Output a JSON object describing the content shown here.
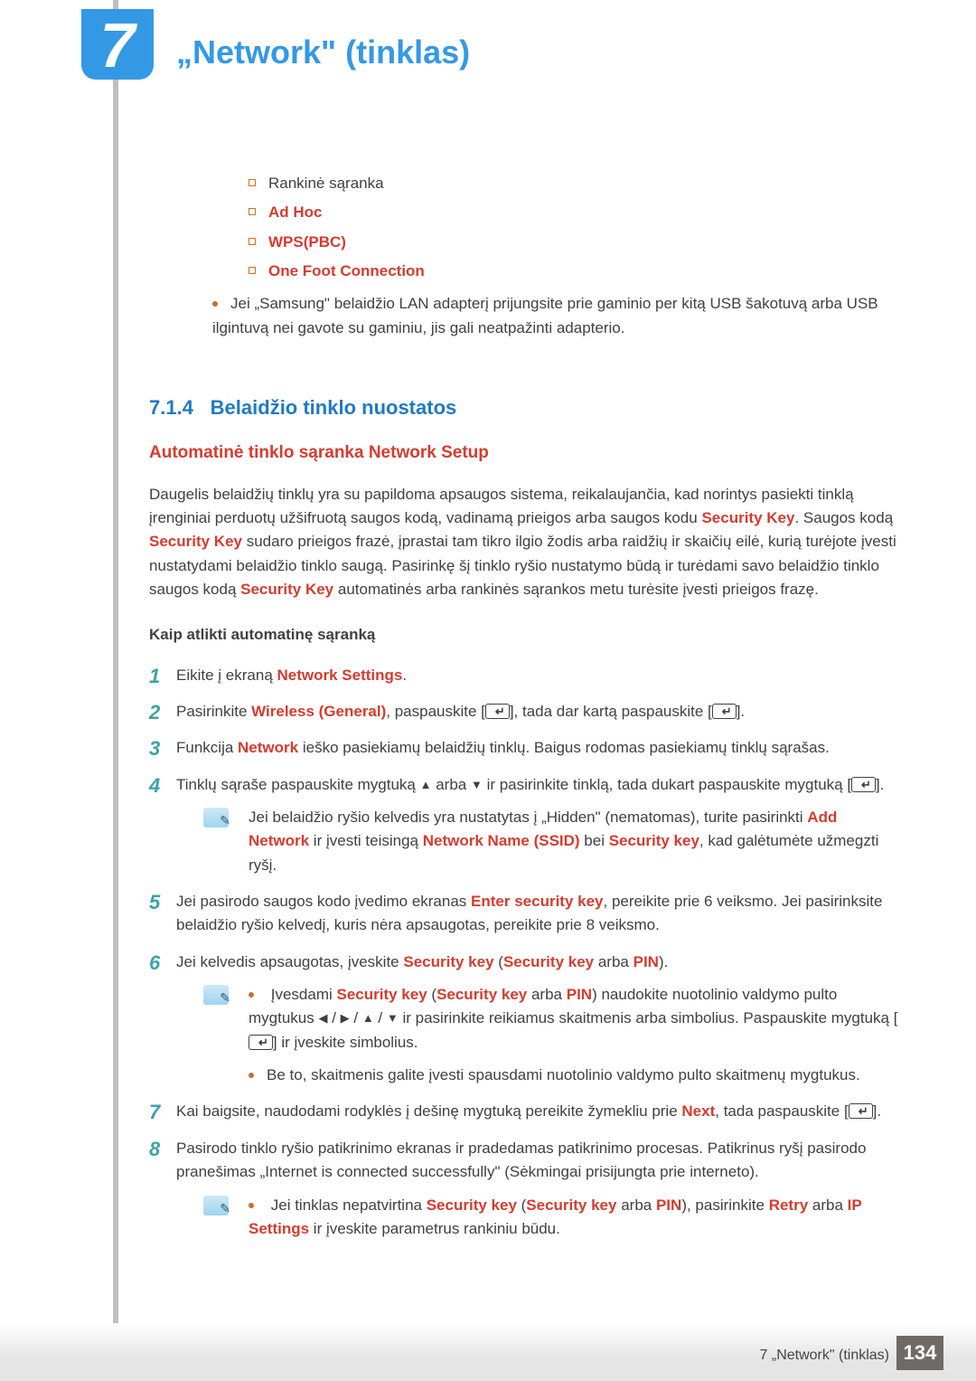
{
  "chapter": {
    "number": "7",
    "title": "„Network\" (tinklas)"
  },
  "topList": {
    "a": "Rankinė sąranka",
    "b": "Ad Hoc",
    "c": "WPS(PBC)",
    "d": "One Foot Connection"
  },
  "topDot": "Jei „Samsung\" belaidžio LAN adapterį prijungsite prie gaminio per kitą USB šakotuvą arba USB ilgintuvą nei gavote su gaminiu, jis gali neatpažinti adapterio.",
  "section": {
    "num": "7.1.4",
    "title": "Belaidžio tinklo nuostatos"
  },
  "sub1": "Automatinė tinklo sąranka Network Setup",
  "para": {
    "t1": "Daugelis belaidžių tinklų yra su papildoma apsaugos sistema, reikalaujančia, kad norintys pasiekti tinklą įrenginiai perduotų užšifruotą saugos kodą, vadinamą prieigos arba saugos kodu ",
    "sk1": "Security Key",
    "t2": ". Saugos kodą ",
    "sk2": "Security Key",
    "t3": " sudaro prieigos frazė, įprastai tam tikro ilgio žodis arba raidžių ir skaičių eilė, kurią turėjote įvesti nustatydami belaidžio tinklo saugą. Pasirinkę šį tinklo ryšio nustatymo būdą ir turėdami savo belaidžio tinklo saugos kodą ",
    "sk3": "Security Key",
    "t4": " automatinės arba rankinės sąrankos metu turėsite įvesti prieigos frazę."
  },
  "bold1": "Kaip atlikti automatinę sąranką",
  "steps": {
    "s1a": "Eikite į ekraną ",
    "s1b": "Network Settings",
    "s1c": ".",
    "s2a": "Pasirinkite ",
    "s2b": "Wireless (General)",
    "s2c": ", paspauskite [",
    "s2d": "], tada dar kartą paspauskite [",
    "s2e": "].",
    "s3a": "Funkcija ",
    "s3b": "Network",
    "s3c": " ieško pasiekiamų belaidžių tinklų. Baigus rodomas pasiekiamų tinklų sąrašas.",
    "s4a": "Tinklų sąraše paspauskite mygtuką ",
    "s4b": " arba ",
    "s4c": " ir pasirinkite tinklą, tada dukart paspauskite mygtuką [",
    "s4d": "].",
    "note4a": "Jei belaidžio ryšio kelvedis yra nustatytas į „Hidden\" (nematomas), turite pasirinkti ",
    "note4b": "Add Network",
    "note4c": " ir įvesti teisingą ",
    "note4d": "Network Name (SSID)",
    "note4e": " bei ",
    "note4f": "Security key",
    "note4g": ", kad galėtumėte užmegzti ryšį.",
    "s5a": "Jei pasirodo saugos kodo įvedimo ekranas ",
    "s5b": "Enter security key",
    "s5c": ", pereikite prie 6 veiksmo. Jei pasirinksite belaidžio ryšio kelvedį, kuris nėra apsaugotas, pereikite prie 8 veiksmo.",
    "s6a": "Jei kelvedis apsaugotas, įveskite ",
    "s6b": "Security key",
    "s6c": " (",
    "s6d": "Security key",
    "s6e": " arba ",
    "s6f": "PIN",
    "s6g": ").",
    "note6a": "Įvesdami ",
    "note6b": "Security key",
    "note6c": " (",
    "note6d": "Security key",
    "note6e": " arba ",
    "note6f": "PIN",
    "note6g": ") naudokite nuotolinio valdymo pulto mygtukus ",
    "note6h": " ir pasirinkite reikiamus skaitmenis arba simbolius. Paspauskite mygtuką [",
    "note6i": "] ir įveskite simbolius.",
    "note6j": "Be to, skaitmenis galite įvesti spausdami nuotolinio valdymo pulto skaitmenų mygtukus.",
    "s7a": "Kai baigsite, naudodami rodyklės į dešinę mygtuką pereikite žymekliu prie ",
    "s7b": "Next",
    "s7c": ", tada paspauskite [",
    "s7d": "].",
    "s8a": "Pasirodo tinklo ryšio patikrinimo ekranas ir pradedamas patikrinimo procesas. Patikrinus ryšį pasirodo pranešimas „Internet is connected successfully\" (Sėkmingai prisijungta prie interneto).",
    "note8a": "Jei tinklas nepatvirtina ",
    "note8b": "Security key",
    "note8c": " (",
    "note8d": "Security key",
    "note8e": " arba ",
    "note8f": "PIN",
    "note8g": "), pasirinkite ",
    "note8h": "Retry",
    "note8i": " arba ",
    "note8j": "IP Settings",
    "note8k": " ir įveskite parametrus rankiniu būdu."
  },
  "footer": {
    "crumb": "7 „Network\" (tinklas)",
    "page": "134"
  }
}
